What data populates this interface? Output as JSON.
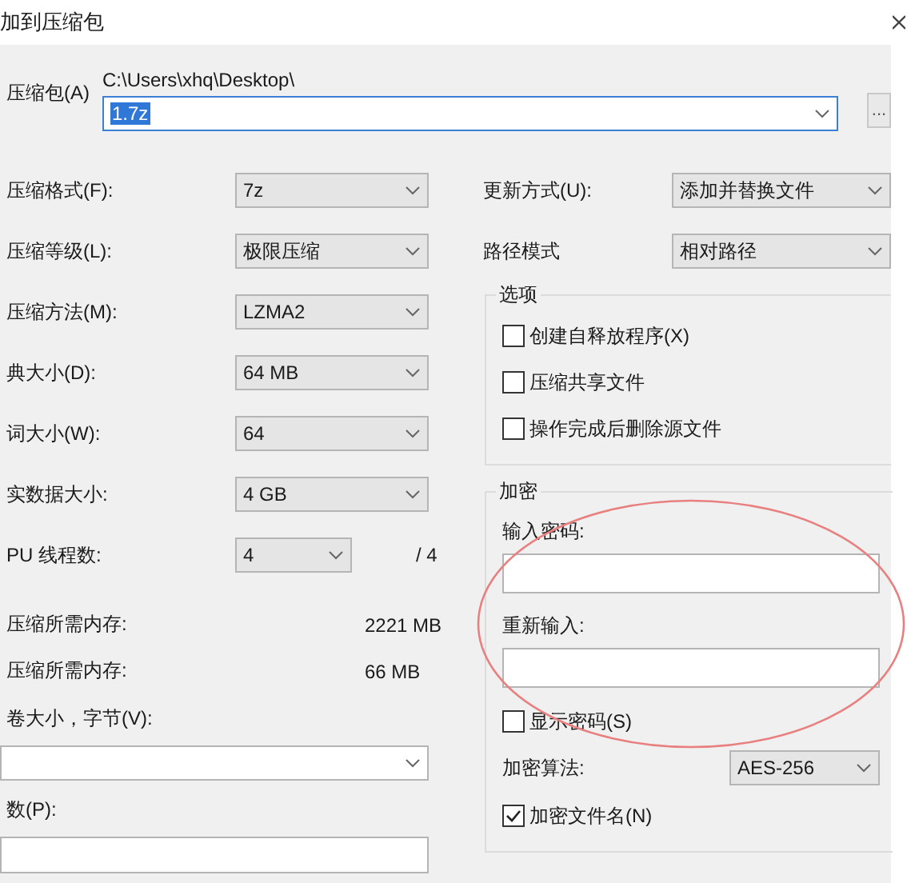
{
  "window": {
    "title": "加到压缩包"
  },
  "archive": {
    "label": "压缩包(A)",
    "path": "C:\\Users\\xhq\\Desktop\\",
    "value": "1.7z",
    "selected": true,
    "browse": "..."
  },
  "settings": [
    {
      "label": "压缩格式(F):",
      "value": "7z"
    },
    {
      "label": "压缩等级(L):",
      "value": "极限压缩"
    },
    {
      "label": "压缩方法(M):",
      "value": "LZMA2"
    },
    {
      "label": "典大小(D):",
      "value": "64 MB"
    },
    {
      "label": "词大小(W):",
      "value": "64"
    },
    {
      "label": "实数据大小:",
      "value": "4 GB"
    },
    {
      "label": "PU 线程数:",
      "value": "4",
      "suffix": "/ 4"
    }
  ],
  "memory": [
    {
      "label": "压缩所需内存:",
      "value": "2221 MB"
    },
    {
      "label": "压缩所需内存:",
      "value": "66 MB"
    }
  ],
  "split_volumes": {
    "label": "卷大小，字节(V):"
  },
  "parameters": {
    "label": "数(P):"
  },
  "update_mode": {
    "label": "更新方式(U):",
    "value": "添加并替换文件"
  },
  "path_mode": {
    "label": "路径模式",
    "value": "相对路径"
  },
  "options": {
    "title": "选项",
    "items": [
      {
        "label": "创建自释放程序(X)",
        "checked": false
      },
      {
        "label": "压缩共享文件",
        "checked": false
      },
      {
        "label": "操作完成后删除源文件",
        "checked": false
      }
    ]
  },
  "encryption": {
    "title": "加密",
    "password_label": "输入密码:",
    "reenter_label": "重新输入:",
    "show_password": {
      "label": "显示密码(S)",
      "checked": false
    },
    "method": {
      "label": "加密算法:",
      "value": "AES-256"
    },
    "encrypt_names": {
      "label": "加密文件名(N)",
      "checked": true
    }
  }
}
